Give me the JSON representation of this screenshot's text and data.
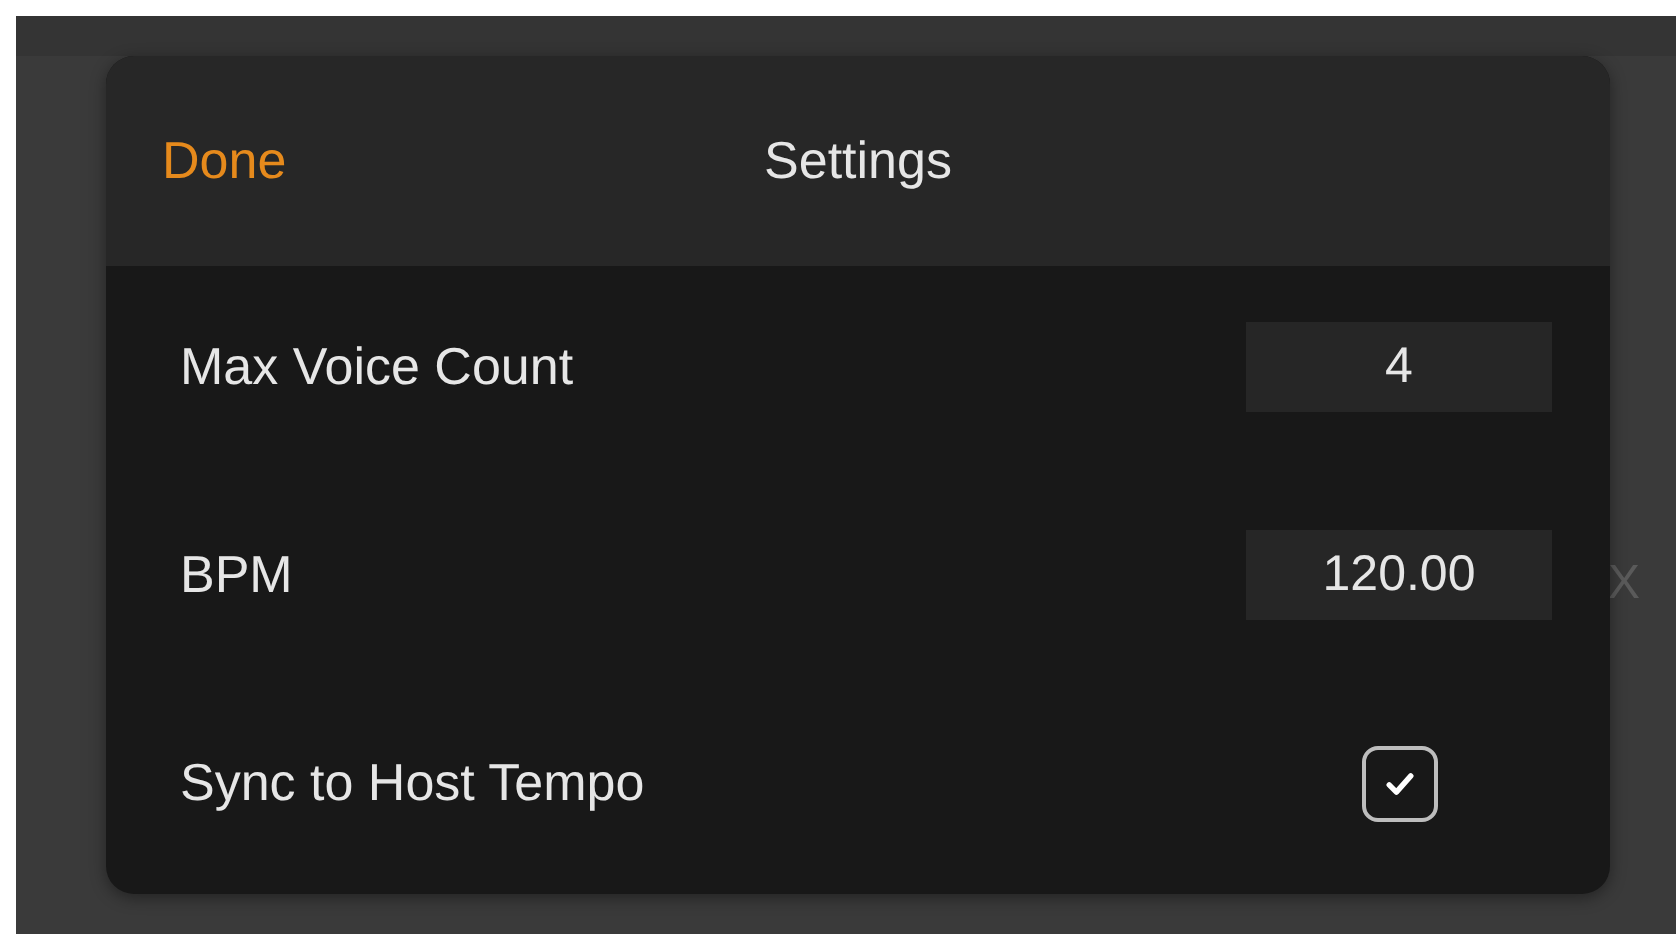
{
  "background": {
    "mark": "X"
  },
  "dialog": {
    "title": "Settings",
    "done_button": "Done",
    "rows": [
      {
        "kind": "input",
        "label": "Max Voice Count",
        "value": "4"
      },
      {
        "kind": "input",
        "label": "BPM",
        "value": "120.00"
      },
      {
        "kind": "checkbox",
        "label": "Sync to Host Tempo",
        "checked": true
      }
    ]
  }
}
